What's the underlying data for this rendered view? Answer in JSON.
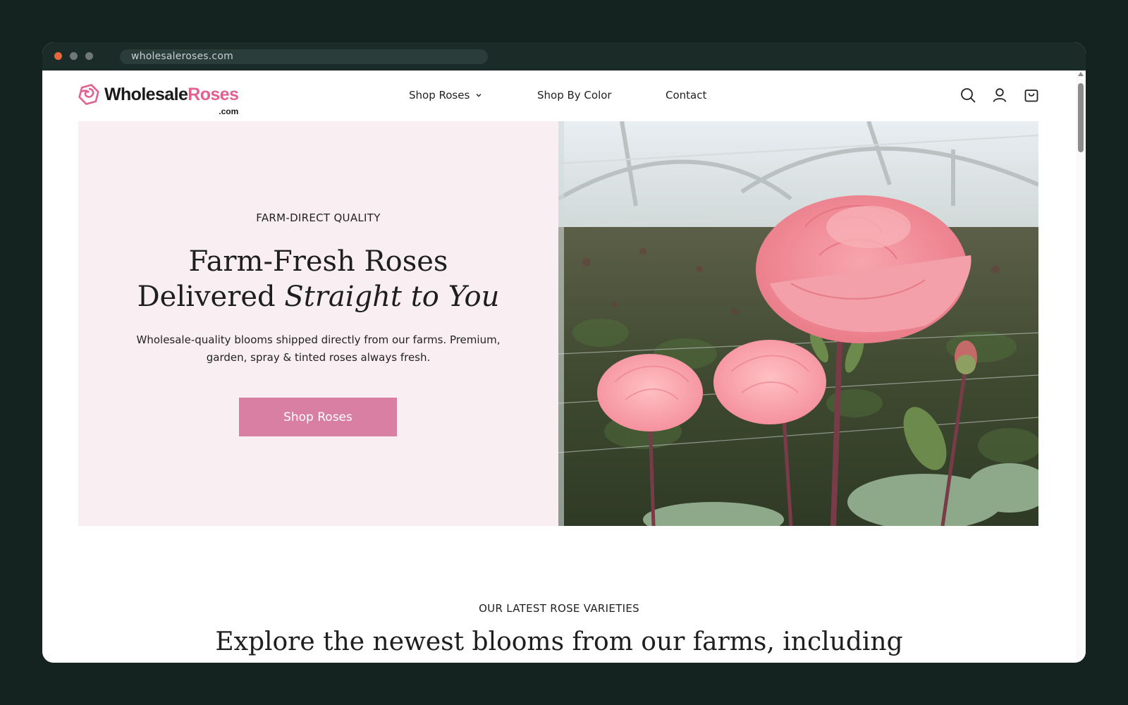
{
  "browser": {
    "url": "wholesaleroses.com"
  },
  "header": {
    "logo": {
      "word1": "Wholesale",
      "word2": "Roses",
      "suffix": ".com"
    },
    "nav": {
      "shop_roses": "Shop Roses",
      "shop_by_color": "Shop By Color",
      "contact": "Contact"
    },
    "icons": [
      "search-icon",
      "account-icon",
      "cart-icon"
    ]
  },
  "hero": {
    "eyebrow": "FARM-DIRECT QUALITY",
    "title_line1": "Farm-Fresh Roses",
    "title_line2_plain": "Delivered ",
    "title_line2_italic": "Straight to You",
    "subtitle": "Wholesale-quality blooms shipped directly from our farms. Premium, garden, spray & tinted roses always fresh.",
    "button": "Shop Roses"
  },
  "latest": {
    "eyebrow": "OUR LATEST ROSE VARIETIES",
    "title": "Explore the newest blooms from our farms, including"
  },
  "colors": {
    "brand_pink": "#e2618f",
    "button_pink": "#d97fa3",
    "hero_bg": "#f9eff3",
    "frame_dark": "#142220"
  }
}
